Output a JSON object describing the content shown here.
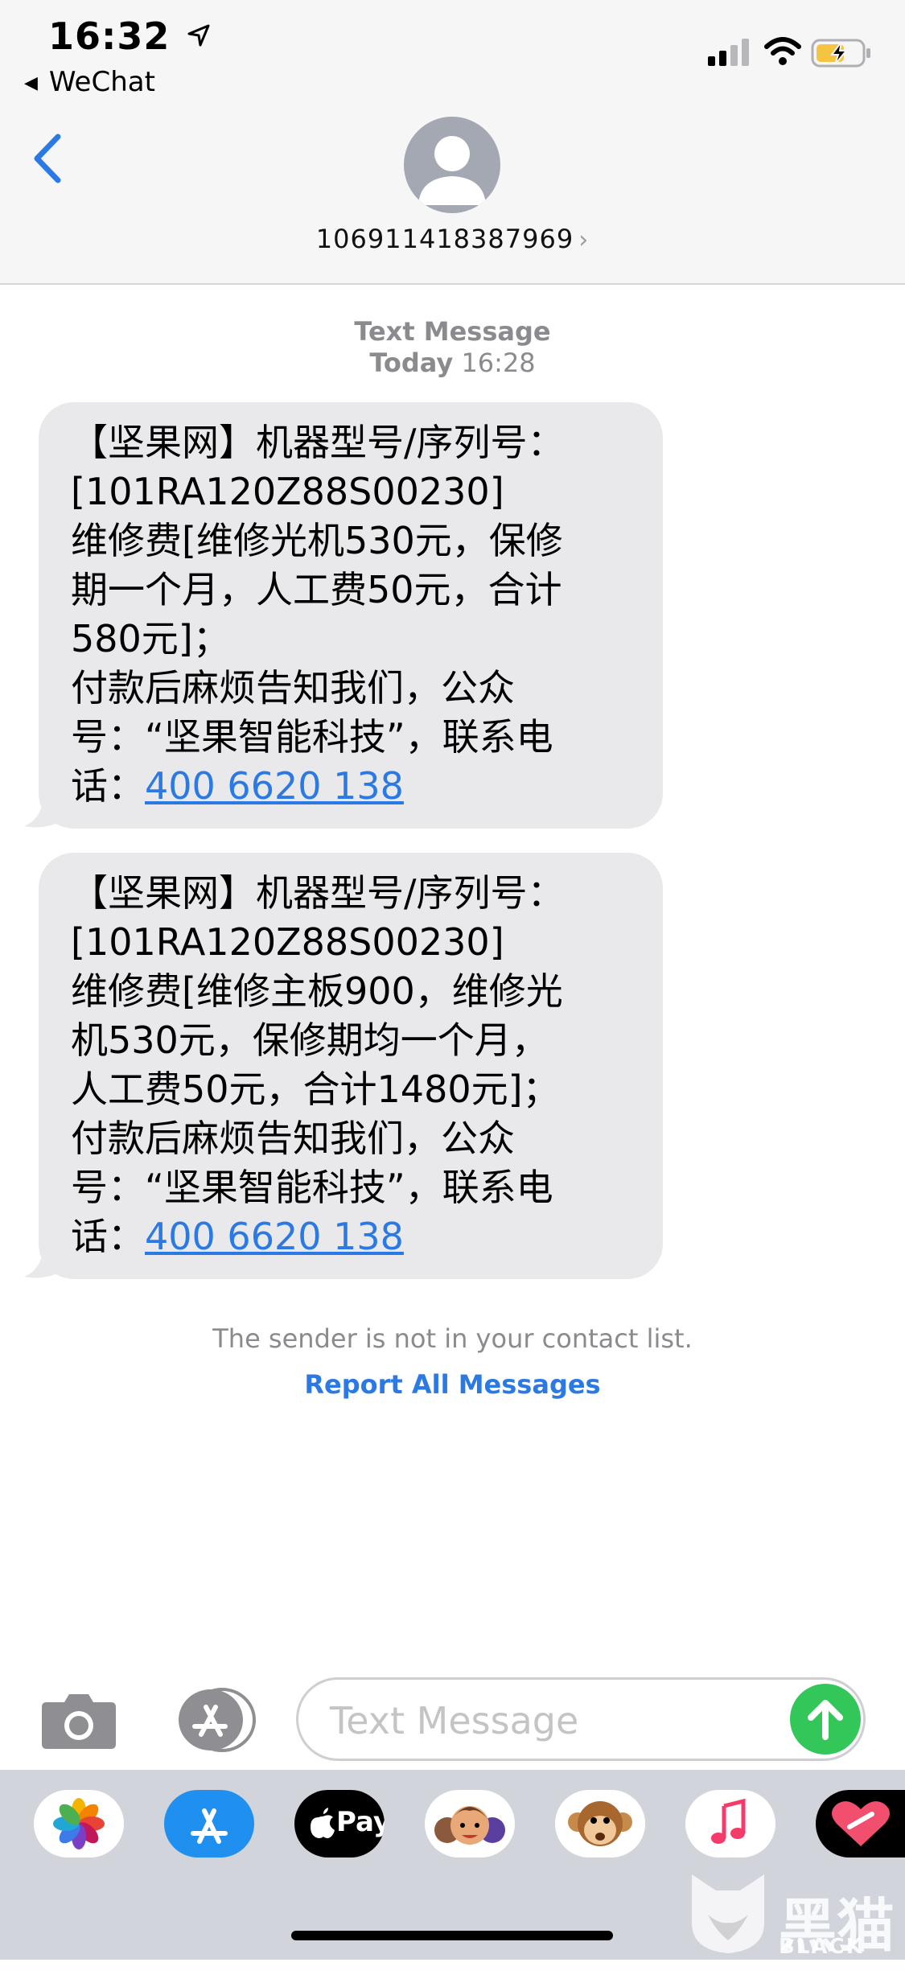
{
  "status_bar": {
    "time": "16:32",
    "back_app": "WeChat",
    "icons": [
      "location-arrow-icon",
      "signal-icon",
      "wifi-icon",
      "battery-charging-icon"
    ]
  },
  "header": {
    "contact": "106911418387969"
  },
  "thread": {
    "type_label": "Text Message",
    "day": "Today",
    "time": "16:28",
    "messages": [
      {
        "text": "【坚果网】机器型号/序列号：\n[101RA120Z88S00230]\n维修费[维修光机530元，保修\n期一个月，人工费50元，合计\n580元]；\n付款后麻烦告知我们，公众\n号：“坚果智能科技”，联系电\n话：",
        "link": "400 6620 138"
      },
      {
        "text": "【坚果网】机器型号/序列号：\n[101RA120Z88S00230]\n维修费[维修主板900，维修光\n机530元，保修期均一个月，\n人工费50元，合计1480元]；\n付款后麻烦告知我们，公众\n号：“坚果智能科技”，联系电\n话：",
        "link": "400 6620 138"
      }
    ],
    "sender_note": "The sender is not in your contact list.",
    "report_link": "Report All Messages"
  },
  "input": {
    "placeholder": "Text Message"
  },
  "app_drawer": {
    "apps": [
      "photos-app-icon",
      "app-store-icon",
      "apple-pay-icon",
      "memoji-stickers-icon",
      "animoji-icon",
      "music-app-icon",
      "digital-touch-icon"
    ],
    "apple_pay_label": "Pay"
  },
  "watermark": {
    "text": "黑猫",
    "sub": "BLACK CAT"
  },
  "colors": {
    "link_blue": "#2a79e4",
    "bubble_gray": "#e9e9eb",
    "send_green": "#33c759"
  }
}
